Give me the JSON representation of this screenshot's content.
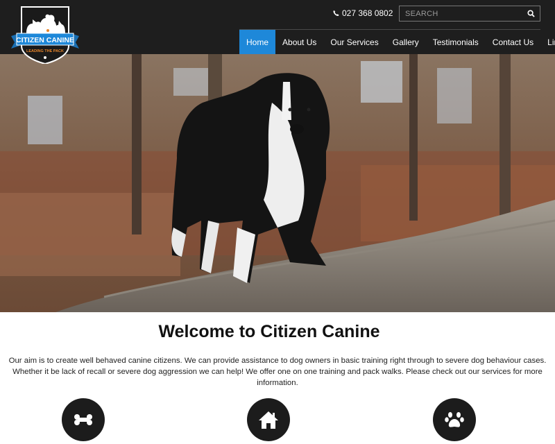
{
  "brand": {
    "logo_text": "CITIZEN CANINE",
    "logo_tagline": "LEADING THE PACK",
    "accent_color": "#1e88d9",
    "header_bg": "#1e1e1e"
  },
  "header": {
    "phone_icon": "phone-icon",
    "phone": "027 368 0802",
    "search": {
      "placeholder": "SEARCH",
      "icon": "search-icon"
    }
  },
  "nav": {
    "items": [
      {
        "label": "Home",
        "active": true
      },
      {
        "label": "About Us"
      },
      {
        "label": "Our Services"
      },
      {
        "label": "Gallery"
      },
      {
        "label": "Testimonials"
      },
      {
        "label": "Contact Us"
      },
      {
        "label": "Links"
      }
    ]
  },
  "hero": {
    "image": "border-collie-on-log-photo"
  },
  "main": {
    "title": "Welcome to Citizen Canine",
    "intro": "Our aim is to create well behaved canine citizens. We can provide assistance to dog owners in basic training right through to severe dog behaviour cases. Whether it be lack of recall or severe dog aggression we can help! We offer one on one training and pack walks. Please check out our services for more information."
  },
  "services": {
    "icons": [
      "bone-icon",
      "home-icon",
      "paw-icon"
    ]
  }
}
